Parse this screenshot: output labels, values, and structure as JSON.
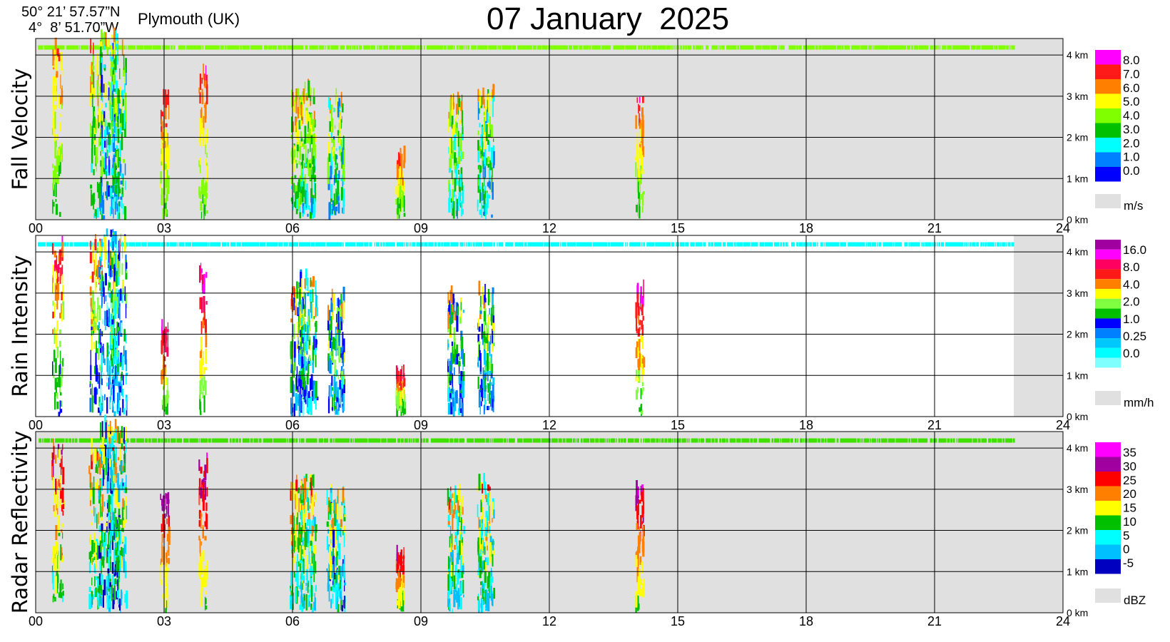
{
  "header": {
    "lat": "50° 21’ 57.57”N",
    "lon": "4°  8’ 51.70”W",
    "location": "Plymouth (UK)",
    "date": "07 January  2025"
  },
  "chart_data": [
    {
      "type": "heatmap",
      "title": "Fall Velocity",
      "unit": "m/s",
      "x_ticks": [
        "00",
        "03",
        "06",
        "09",
        "12",
        "15",
        "18",
        "21",
        "24"
      ],
      "xlim": [
        0,
        24
      ],
      "y_ticks": [
        "0 km",
        "1 km",
        "2 km",
        "3 km",
        "4 km"
      ],
      "ylim": [
        0,
        4.4
      ],
      "grid": true,
      "background": "#e0e0e0",
      "legend_labels": [
        "8.0",
        "7.0",
        "6.0",
        "5.0",
        "4.0",
        "3.0",
        "2.0",
        "1.0",
        "0.0"
      ],
      "legend_colors": [
        "#ff00ff",
        "#ff1a1a",
        "#ff8000",
        "#ffff00",
        "#80ff00",
        "#00c000",
        "#00ffff",
        "#0080ff",
        "#0000ff"
      ],
      "status_band_color": "#80ff00",
      "echoes": [
        {
          "t": 0.5,
          "top": 4.0,
          "intensity": 0.3
        },
        {
          "t": 1.4,
          "top": 4.1,
          "intensity": 0.4
        },
        {
          "t": 1.7,
          "top": 4.4,
          "intensity": 0.7
        },
        {
          "t": 1.9,
          "top": 4.2,
          "intensity": 0.6
        },
        {
          "t": 3.0,
          "top": 2.8,
          "intensity": 0.2
        },
        {
          "t": 3.9,
          "top": 3.5,
          "intensity": 0.2
        },
        {
          "t": 6.1,
          "top": 3.0,
          "intensity": 0.4
        },
        {
          "t": 6.35,
          "top": 3.2,
          "intensity": 0.5
        },
        {
          "t": 7.0,
          "top": 2.8,
          "intensity": 0.6
        },
        {
          "t": 8.5,
          "top": 1.4,
          "intensity": 0.2
        },
        {
          "t": 9.8,
          "top": 2.8,
          "intensity": 0.5
        },
        {
          "t": 10.5,
          "top": 3.0,
          "intensity": 0.6
        },
        {
          "t": 14.1,
          "top": 2.9,
          "intensity": 0.2
        }
      ]
    },
    {
      "type": "heatmap",
      "title": "Rain Intensity",
      "unit": "mm/h",
      "x_ticks": [
        "00",
        "03",
        "06",
        "09",
        "12",
        "15",
        "18",
        "21",
        "24"
      ],
      "xlim": [
        0,
        24
      ],
      "y_ticks": [
        "0 km",
        "1 km",
        "2 km",
        "3 km",
        "4 km"
      ],
      "ylim": [
        0,
        4.4
      ],
      "grid": true,
      "background": "#ffffff",
      "no_data_after": 22.85,
      "legend_labels": [
        "16.0",
        "8.0",
        "4.0",
        "2.0",
        "1.0",
        "0.25",
        "0.0"
      ],
      "legend_colors": [
        "#a000a0",
        "#ff00ff",
        "#ff0060",
        "#ff1a1a",
        "#ff8000",
        "#ffff00",
        "#80ff40",
        "#00c000",
        "#0000ff",
        "#0080ff",
        "#00c8ff",
        "#00ffff",
        "#80ffff"
      ],
      "status_band_color": "#00ffff",
      "echoes": [
        {
          "t": 0.5,
          "top": 4.0,
          "intensity": 0.3
        },
        {
          "t": 1.4,
          "top": 4.1,
          "intensity": 0.4
        },
        {
          "t": 1.7,
          "top": 4.4,
          "intensity": 0.8
        },
        {
          "t": 1.9,
          "top": 4.2,
          "intensity": 0.7
        },
        {
          "t": 3.0,
          "top": 2.2,
          "intensity": 0.15
        },
        {
          "t": 3.9,
          "top": 3.5,
          "intensity": 0.15
        },
        {
          "t": 6.1,
          "top": 3.0,
          "intensity": 0.5
        },
        {
          "t": 6.35,
          "top": 3.2,
          "intensity": 0.7
        },
        {
          "t": 7.0,
          "top": 2.8,
          "intensity": 0.6
        },
        {
          "t": 8.5,
          "top": 1.0,
          "intensity": 0.2
        },
        {
          "t": 9.8,
          "top": 2.8,
          "intensity": 0.6
        },
        {
          "t": 10.5,
          "top": 3.0,
          "intensity": 0.6
        },
        {
          "t": 14.1,
          "top": 2.9,
          "intensity": 0.2
        }
      ]
    },
    {
      "type": "heatmap",
      "title": "Radar Reflectivity",
      "unit": "dBZ",
      "x_ticks": [
        "00",
        "03",
        "06",
        "09",
        "12",
        "15",
        "18",
        "21",
        "24"
      ],
      "xlim": [
        0,
        24
      ],
      "y_ticks": [
        "0 km",
        "1 km",
        "2 km",
        "3 km",
        "4 km"
      ],
      "ylim": [
        0,
        4.4
      ],
      "grid": true,
      "background": "#e0e0e0",
      "legend_labels": [
        "35",
        "30",
        "25",
        "20",
        "15",
        "10",
        "5",
        "0",
        "-5"
      ],
      "legend_colors": [
        "#ff00ff",
        "#a000a0",
        "#ff0000",
        "#ff8000",
        "#ffff00",
        "#00c000",
        "#00ffff",
        "#00c0ff",
        "#0000c0"
      ],
      "status_band_color": "#40e000",
      "echoes": [
        {
          "t": 0.5,
          "top": 4.0,
          "intensity": 0.35
        },
        {
          "t": 1.4,
          "top": 4.1,
          "intensity": 0.5
        },
        {
          "t": 1.7,
          "top": 4.4,
          "intensity": 0.8
        },
        {
          "t": 1.9,
          "top": 4.2,
          "intensity": 0.7
        },
        {
          "t": 3.0,
          "top": 2.8,
          "intensity": 0.2
        },
        {
          "t": 3.9,
          "top": 3.5,
          "intensity": 0.2
        },
        {
          "t": 6.1,
          "top": 3.0,
          "intensity": 0.5
        },
        {
          "t": 6.35,
          "top": 3.2,
          "intensity": 0.6
        },
        {
          "t": 7.0,
          "top": 2.8,
          "intensity": 0.7
        },
        {
          "t": 8.5,
          "top": 1.4,
          "intensity": 0.2
        },
        {
          "t": 9.8,
          "top": 2.8,
          "intensity": 0.6
        },
        {
          "t": 10.5,
          "top": 3.0,
          "intensity": 0.6
        },
        {
          "t": 14.1,
          "top": 2.9,
          "intensity": 0.2
        }
      ]
    }
  ]
}
